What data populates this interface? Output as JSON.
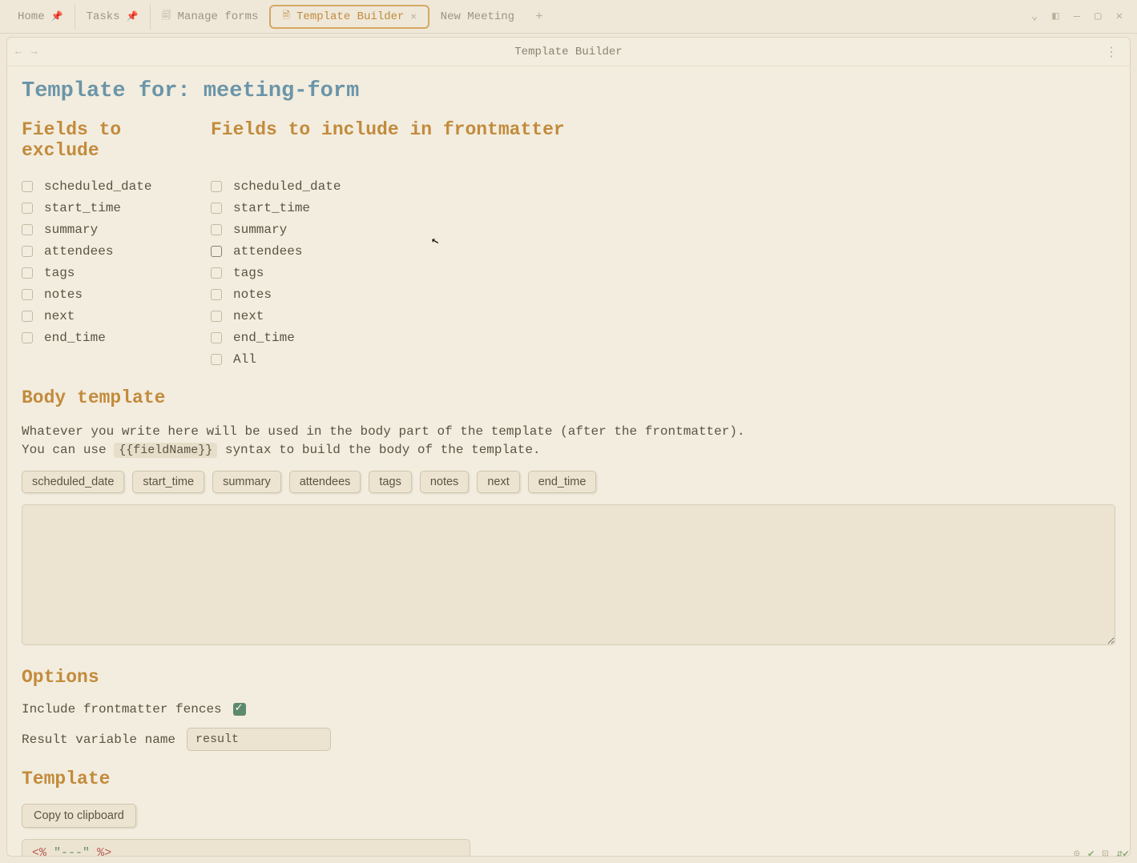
{
  "titlebar": {
    "tabs": [
      {
        "label": "Home",
        "pinned": true
      },
      {
        "label": "Tasks",
        "pinned": true
      },
      {
        "label": "Manage forms",
        "icon": "doc"
      },
      {
        "label": "Template Builder",
        "icon": "doc",
        "active": true,
        "closeable": true
      },
      {
        "label": "New Meeting"
      }
    ]
  },
  "content_header": {
    "title": "Template Builder"
  },
  "page": {
    "title": "Template for: meeting-form",
    "exclude_heading": "Fields to exclude",
    "include_heading": "Fields to include in frontmatter",
    "fields": [
      "scheduled_date",
      "start_time",
      "summary",
      "attendees",
      "tags",
      "notes",
      "next",
      "end_time"
    ],
    "include_extra": "All",
    "body_heading": "Body template",
    "body_desc_1": "Whatever you write here will be used in the body part of the template (after the frontmatter).",
    "body_desc_2a": "You can use ",
    "body_desc_code": "{{fieldName}}",
    "body_desc_2b": " syntax to build the body of the template.",
    "pills": [
      "scheduled_date",
      "start_time",
      "summary",
      "attendees",
      "tags",
      "notes",
      "next",
      "end_time"
    ],
    "options_heading": "Options",
    "opt_fences_label": "Include frontmatter fences",
    "opt_fences_checked": true,
    "opt_var_label": "Result variable name",
    "opt_var_value": "result",
    "template_heading": "Template",
    "copy_label": "Copy to clipboard",
    "code_red1": "<%",
    "code_green": "\"---\"",
    "code_red2": "%>"
  }
}
